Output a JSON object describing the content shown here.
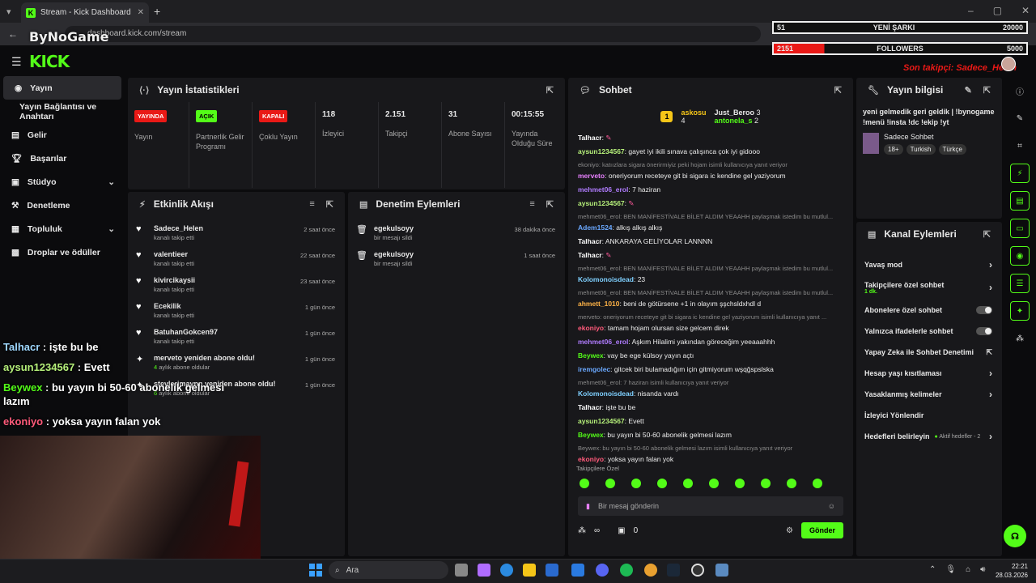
{
  "browser": {
    "tab_title": "Stream - Kick Dashboard",
    "url": "dashboard.kick.com/stream",
    "watermark": "ByNoGame"
  },
  "overlay_bars": {
    "song": {
      "left": "51",
      "label": "YENİ ŞARKI",
      "right": "20000"
    },
    "followers": {
      "left": "2151",
      "label": "FOLLOWERS",
      "right": "5000"
    },
    "last_follower": "Son takipçi: Sadece_Helen"
  },
  "sidebar": {
    "items": [
      {
        "label": "Yayın"
      },
      {
        "label": "Yayın Bağlantısı ve Anahtarı"
      },
      {
        "label": "Gelir"
      },
      {
        "label": "Başarılar"
      },
      {
        "label": "Stüdyo"
      },
      {
        "label": "Denetleme"
      },
      {
        "label": "Topluluk"
      },
      {
        "label": "Droplar ve ödüller"
      }
    ]
  },
  "stats": {
    "title": "Yayın İstatistikleri",
    "cells": [
      {
        "badge": "YAYINDA",
        "label": "Yayın"
      },
      {
        "badge": "AÇIK",
        "label": "Partnerlik Gelir Programı"
      },
      {
        "badge": "KAPALI",
        "label": "Çoklu Yayın"
      },
      {
        "value": "118",
        "label": "İzleyici"
      },
      {
        "value": "2.151",
        "label": "Takipçi"
      },
      {
        "value": "31",
        "label": "Abone Sayısı"
      },
      {
        "value": "00:15:55",
        "label": "Yayında Olduğu Süre"
      }
    ]
  },
  "activity": {
    "title": "Etkinlik Akışı",
    "items": [
      {
        "name": "Sadece_Helen",
        "sub": "kanalı takip etti",
        "time": "2 saat önce"
      },
      {
        "name": "valentieer",
        "sub": "kanalı takip etti",
        "time": "22 saat önce"
      },
      {
        "name": "kivircikaysii",
        "sub": "kanalı takip etti",
        "time": "23 saat önce"
      },
      {
        "name": "Ecekilik",
        "sub": "kanalı takip etti",
        "time": "1 gün önce"
      },
      {
        "name": "BatuhanGokcen97",
        "sub": "kanalı takip etti",
        "time": "1 gün önce"
      },
      {
        "name": "merveto yeniden abone oldu!",
        "sub_num": "4",
        "sub": "aylık abone oldular",
        "time": "1 gün önce"
      },
      {
        "name": "stevlerimaynn yeniden abone oldu!",
        "sub_num": "6",
        "sub": "aylık abone oldular",
        "time": "1 gün önce"
      }
    ]
  },
  "moderation": {
    "title": "Denetim Eylemleri",
    "items": [
      {
        "name": "egekulsoyy",
        "sub": "bir mesajı sildi",
        "time": "38 dakika önce"
      },
      {
        "name": "egekulsoyy",
        "sub": "bir mesajı sildi",
        "time": "1 saat önce"
      }
    ]
  },
  "chat": {
    "title": "Sohbet",
    "top_gifter": {
      "name": "askosu",
      "rank": "1",
      "count": "4"
    },
    "gifters": [
      {
        "name": "Just_Beroo",
        "count": "3"
      },
      {
        "name": "antonela_s",
        "count": "2"
      }
    ],
    "messages": [
      {
        "user": "Talhacr",
        "text": "",
        "color": "#ffffff"
      },
      {
        "user": "aysun1234567",
        "text": "gayet iyi ikili sınava çalışınca çok iyi gidooo",
        "color": "#b6f07a"
      },
      {
        "reply": "ekoniyo: katıızlara sigara önerirmiyiz peki hojam isimli kullanıcıya yanıt veriyor"
      },
      {
        "user": "merveto",
        "text": "oneriyorum receteye git bi sigara ic kendine gel yaziyorum",
        "color": "#e880ff"
      },
      {
        "user": "mehmet06_erol",
        "text": "7 haziran",
        "color": "#b07cff"
      },
      {
        "user": "aysun1234567",
        "text": "",
        "color": "#b6f07a"
      },
      {
        "reply": "mehmet06_erol: BEN MANİFESTİVALE BİLET ALDIM YEAAHH paylaşmak istedim bu mutlul..."
      },
      {
        "user": "Adem1524",
        "text": "alkış alkış alkış",
        "color": "#6aa8ff"
      },
      {
        "user": "Talhacr",
        "text": "ANKARAYA GELİYOLAR LANNNN",
        "color": "#ffffff"
      },
      {
        "user": "Talhacr",
        "text": "",
        "color": "#ffffff"
      },
      {
        "reply": "mehmet06_erol: BEN MANİFESTİVALE BİLET ALDIM YEAAHH paylaşmak istedim bu mutlul..."
      },
      {
        "user": "Kolomonoisdead",
        "text": "23",
        "color": "#7fd0ff"
      },
      {
        "reply": "mehmet06_erol: BEN MANİFESTİVALE BİLET ALDIM YEAAHH paylaşmak istedim bu mutlul..."
      },
      {
        "user": "ahmett_1010",
        "text": "beni de götürsene +1 in olayım şşchsldxhdl d",
        "color": "#ffb347"
      },
      {
        "reply": "merveto: oneriyorum receteye git bi sigara ic kendine gel yaziyorum isimli kullanıcıya yanıt ..."
      },
      {
        "user": "ekoniyo",
        "text": "tamam hojam olursan size gelcem direk",
        "color": "#ff5a7a"
      },
      {
        "user": "mehmet06_erol",
        "text": "Aşkım Hilalimi yakından göreceğim yeeaaahhh",
        "color": "#b07cff"
      },
      {
        "user": "Beywex",
        "text": "vay be ege külsoy yayın açtı",
        "color": "#53fc18"
      },
      {
        "user": "iremgolec",
        "text": "gitcek biri bulamadığım için gitmiyorum wşqğspslska",
        "color": "#6aa8ff"
      },
      {
        "reply": "mehmet06_erol: 7 haziran isimli kullanıcıya yanıt veriyor"
      },
      {
        "user": "Kolomonoisdead",
        "text": "nisanda vardı",
        "color": "#7fd0ff"
      },
      {
        "user": "Talhacr",
        "text": "işte bu be",
        "color": "#ffffff"
      },
      {
        "user": "aysun1234567",
        "text": "Evett",
        "color": "#b6f07a"
      },
      {
        "user": "Beywex",
        "text": "bu yayın bi 50-60 abonelik gelmesi lazım",
        "color": "#53fc18"
      },
      {
        "reply": "Beywex: bu yayın bi 50-60 abonelik gelmesi lazım isimli kullanıcıya yanıt veriyor"
      },
      {
        "user": "ekoniyo",
        "text": "yoksa yayın falan yok",
        "color": "#ff5a7a"
      }
    ],
    "followers_only": "Takipçilere Özel",
    "input_placeholder": "Bir mesaj gönderin",
    "points": "∞",
    "gift_count": "0",
    "send_label": "Gönder"
  },
  "stream_info": {
    "title": "Yayın bilgisi",
    "description": "yeni gelmedik geri geldik | !bynogame !menü !insta !dc !ekip !yt",
    "category": "Sadece Sohbet",
    "tags": [
      "18+",
      "Turkish",
      "Türkçe"
    ]
  },
  "channel_actions": {
    "title": "Kanal Eylemleri",
    "rows": [
      {
        "label": "Yavaş mod",
        "type": "arrow"
      },
      {
        "label": "Takipçilere özel sohbet",
        "sub": "1 dk.",
        "type": "arrow"
      },
      {
        "label": "Abonelere özel sohbet",
        "type": "toggle"
      },
      {
        "label": "Yalnızca ifadelerle sohbet",
        "type": "toggle"
      },
      {
        "label": "Yapay Zeka ile Sohbet Denetimi",
        "type": "external"
      },
      {
        "label": "Hesap yaşı kısıtlaması",
        "type": "arrow"
      },
      {
        "label": "Yasaklanmış kelimeler",
        "type": "arrow"
      },
      {
        "label": "İzleyici Yönlendir",
        "type": "none"
      },
      {
        "label": "Hedefleri belirleyin",
        "extra": "Aktif hedefler - 2",
        "type": "arrow"
      }
    ]
  },
  "stream_overlay_chat": [
    {
      "user": "Talhacr",
      "text": "işte bu be",
      "color": "#9fd8ff"
    },
    {
      "user": "aysun1234567",
      "text": "Evett",
      "color": "#b6f07a"
    },
    {
      "user": "Beywex",
      "text": "bu yayın bi 50-60 abonelik gelmesi lazım",
      "color": "#53fc18"
    },
    {
      "user": "ekoniyo",
      "text": "yoksa yayın falan yok",
      "color": "#ff5a7a"
    }
  ],
  "taskbar": {
    "search": "Ara",
    "time": "22:21",
    "date": "28.03.2026"
  },
  "colors": {
    "accent": "#53fc18",
    "panel": "#18181b",
    "live": "#e91916"
  }
}
